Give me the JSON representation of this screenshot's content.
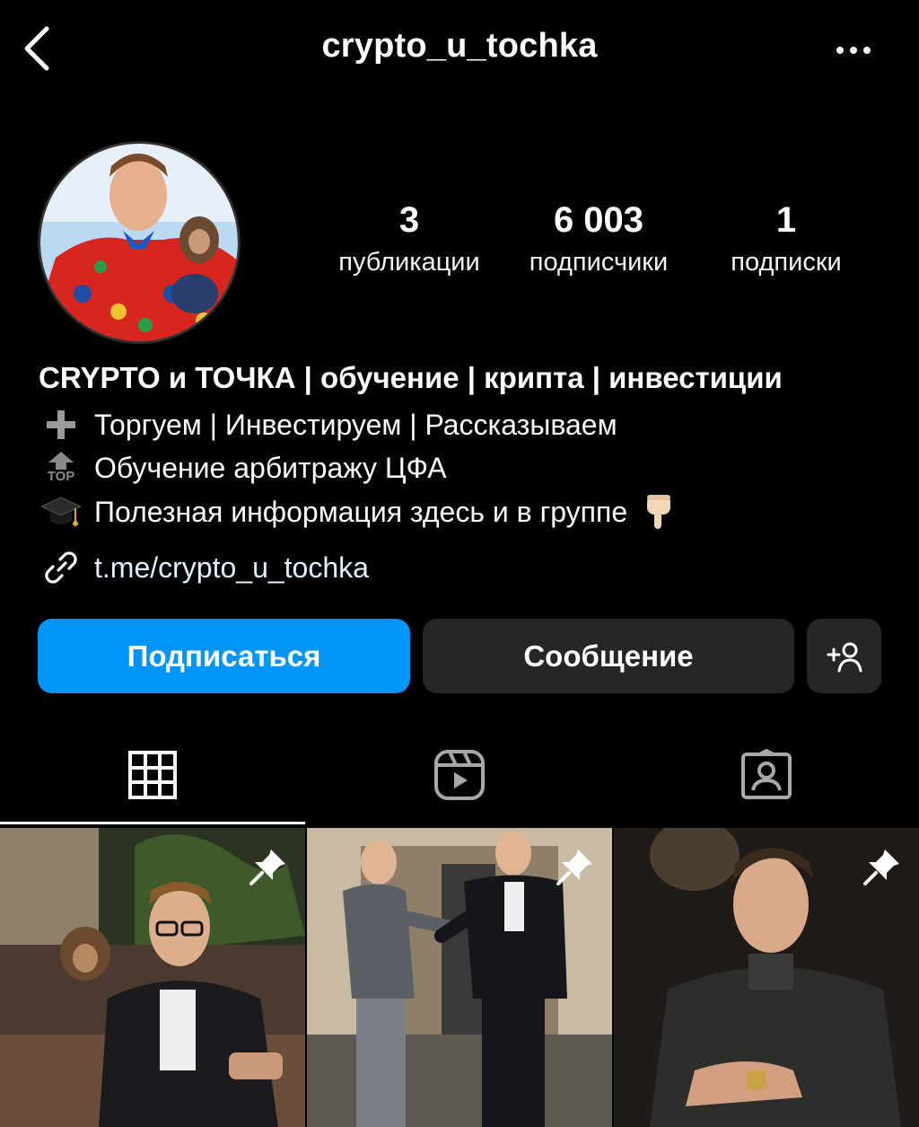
{
  "header": {
    "username": "crypto_u_tochka"
  },
  "stats": {
    "posts_count": "3",
    "posts_label": "публикации",
    "followers_count": "6 003",
    "followers_label": "подписчики",
    "following_count": "1",
    "following_label": "подписки"
  },
  "bio": {
    "display_name": "CRYPTO и ТОЧКА | обучение | крипта | инвестиции",
    "line1_text": "Торгуем | Инвестируем | Рассказываем",
    "line2_text": "Обучение арбитражу ЦФА",
    "line3_text": "Полезная информация здесь и в группе",
    "top_badge": "TOP",
    "link": "t.me/crypto_u_tochka"
  },
  "actions": {
    "follow_label": "Подписаться",
    "message_label": "Сообщение",
    "add_user_label": "+"
  },
  "colors": {
    "background": "#000000",
    "primary_button": "#0095f6",
    "secondary_button": "#262626"
  },
  "tabs": [
    "grid-icon",
    "reels-icon",
    "tagged-icon"
  ],
  "posts": [
    {
      "pinned": true
    },
    {
      "pinned": true
    },
    {
      "pinned": true
    }
  ]
}
